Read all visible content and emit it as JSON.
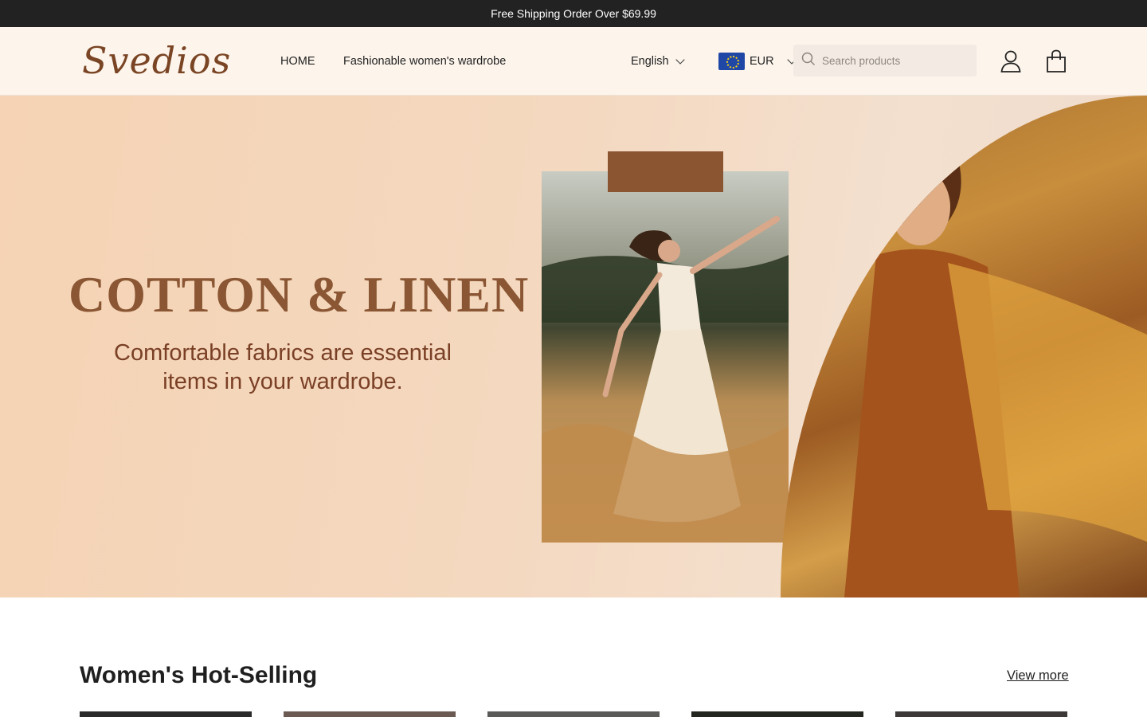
{
  "announcement": "Free Shipping Order Over $69.99",
  "header": {
    "logo": "Svedios",
    "nav": [
      {
        "label": "HOME"
      },
      {
        "label": "Fashionable women's wardrobe"
      }
    ],
    "language": "English",
    "currency": "EUR",
    "search_placeholder": "Search products",
    "icons": {
      "search": "search-icon",
      "user": "user-icon",
      "cart": "shopping-bag-icon",
      "flag": "eu-flag-icon",
      "dropdown": "chevron-down-icon"
    }
  },
  "hero": {
    "title": "COTTON & LINEN",
    "subtitle_line1": "Comfortable fabrics are essential",
    "subtitle_line2": "items in your wardrobe."
  },
  "section": {
    "title": "Women's Hot-Selling",
    "view_more": "View more"
  },
  "colors": {
    "brand": "#7a4524",
    "hero_title": "#8a5633",
    "hero_subtitle": "#7a4026",
    "announcement_bg": "#222222",
    "header_bg": "#fdf5ec"
  }
}
